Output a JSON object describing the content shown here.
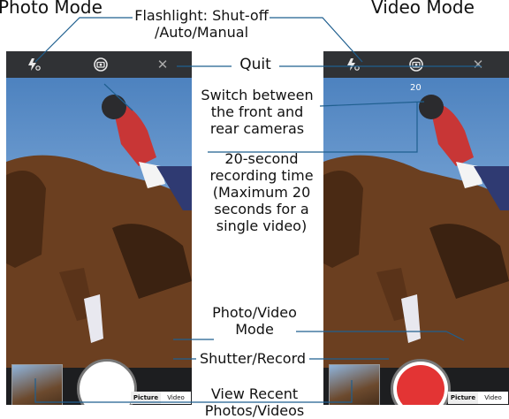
{
  "titles": {
    "photo_mode": "Photo Mode",
    "video_mode": "Video Mode"
  },
  "annotations": {
    "flashlight": [
      "Flashlight: Shut-off",
      "/Auto/Manual"
    ],
    "quit": "Quit",
    "switch_camera": [
      "Switch between",
      "the front and",
      "rear cameras"
    ],
    "recording_time": [
      "20-second",
      "recording time",
      "(Maximum 20",
      "seconds for a",
      "single video)"
    ],
    "photo_video_mode": [
      "Photo/Video",
      "Mode"
    ],
    "shutter_record": "Shutter/Record",
    "view_recent": [
      "View Recent",
      "Photos/Videos"
    ]
  },
  "camera_ui": {
    "flash_icon": "flash-auto-icon",
    "switch_icon": "camera-switch-icon",
    "close_icon": "close-icon",
    "close_glyph": "✕",
    "toggle_picture": "Picture",
    "toggle_video": "Video",
    "timer": "20"
  },
  "colors": {
    "top_bar": "#303235",
    "bottom_bar": "#1d1e20",
    "record": "#e33434",
    "sky": "#6f9fd3"
  }
}
